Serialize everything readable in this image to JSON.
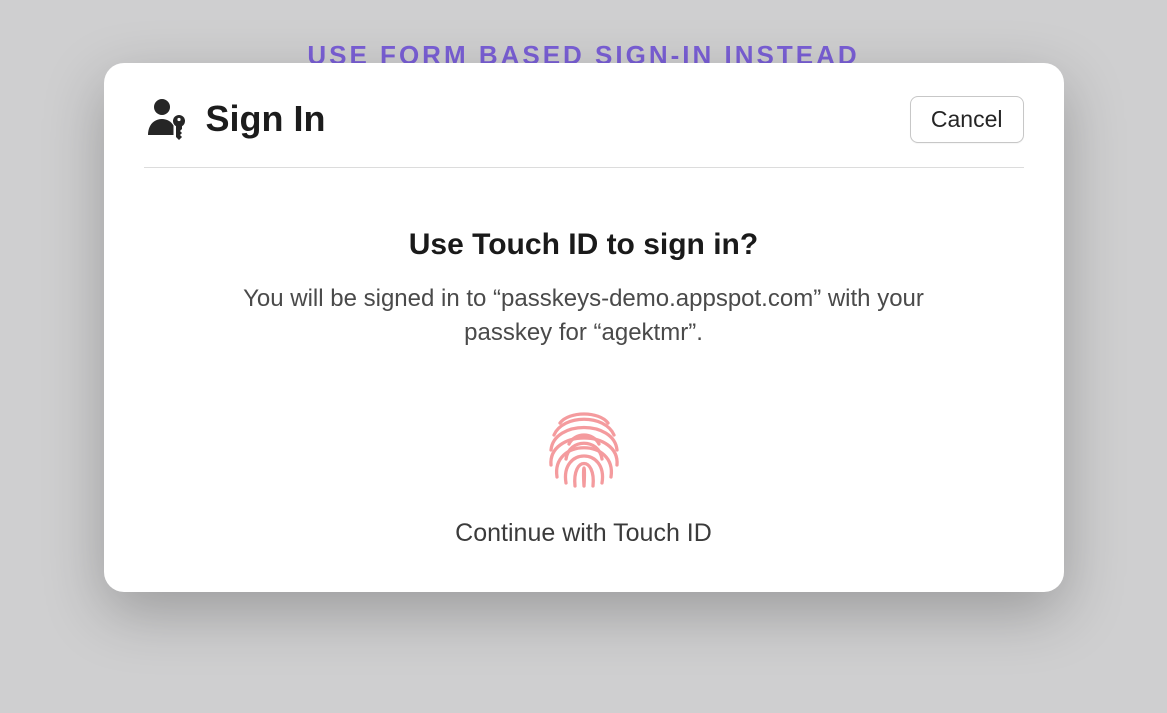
{
  "background": {
    "link_text": "USE FORM BASED SIGN-IN INSTEAD"
  },
  "dialog": {
    "title": "Sign In",
    "cancel_label": "Cancel",
    "prompt_title": "Use Touch ID to sign in?",
    "prompt_description": "You will be signed in to “passkeys-demo.appspot.com” with your passkey for “agektmr”.",
    "continue_label": "Continue with Touch ID"
  }
}
